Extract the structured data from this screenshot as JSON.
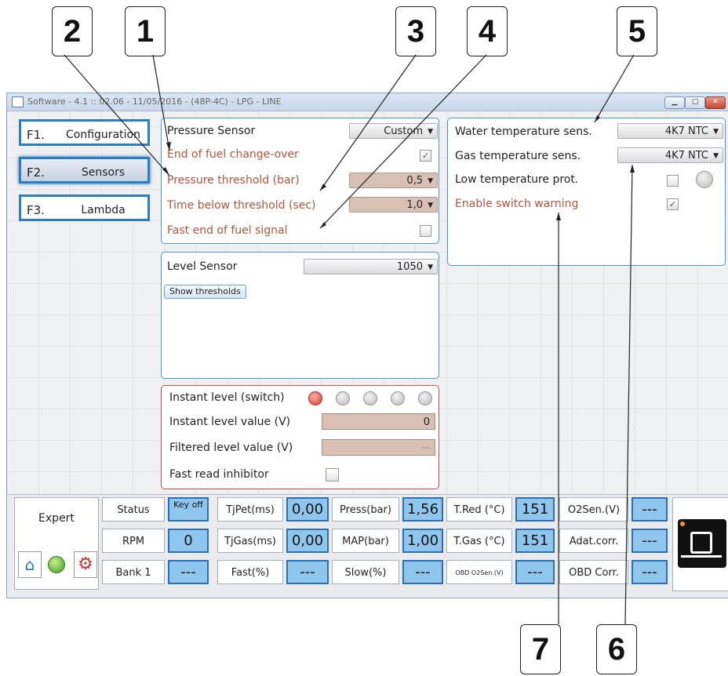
{
  "callouts": [
    "2",
    "1",
    "3",
    "4",
    "5",
    "7",
    "6"
  ],
  "window": {
    "title": "Software - 4.1 :: 02.06 - 11/05/2016 - (48P-4C) - LPG - LINE",
    "buttons": {
      "minimize": "▁",
      "maximize": "▢",
      "close": "✕"
    }
  },
  "nav": [
    {
      "key": "F1.",
      "label": "Configuration"
    },
    {
      "key": "F2.",
      "label": "Sensors"
    },
    {
      "key": "F3.",
      "label": "Lambda"
    }
  ],
  "pressure": {
    "title": "Pressure Sensor",
    "title_value": "Custom",
    "end_of_fuel": "End of fuel change-over",
    "end_of_fuel_checked": "✓",
    "threshold_label": "Pressure threshold (bar)",
    "threshold_value": "0,5",
    "time_label": "Time below threshold (sec)",
    "time_value": "1,0",
    "fast_end_label": "Fast end of fuel signal"
  },
  "level": {
    "title": "Level Sensor",
    "value": "1050",
    "show_thresholds": "Show thresholds"
  },
  "instant": {
    "switch_label": "Instant level (switch)",
    "value_label": "Instant level value (V)",
    "value": "0",
    "filtered_label": "Filtered level value (V)",
    "filtered_value": "---",
    "inhibitor_label": "Fast read inhibitor"
  },
  "temps": {
    "water_label": "Water temperature sens.",
    "water_value": "4K7 NTC",
    "gas_label": "Gas temperature sens.",
    "gas_value": "4K7 NTC",
    "low_label": "Low temperature prot.",
    "warning_label": "Enable switch warning",
    "warning_checked": "✓"
  },
  "status": {
    "mode": "Expert",
    "rows": [
      [
        {
          "label": "Status",
          "value": "Key off"
        },
        {
          "label": "TjPet(ms)",
          "value": "0,00"
        },
        {
          "label": "Press(bar)",
          "value": "1,56"
        },
        {
          "label": "T.Red (°C)",
          "value": "151"
        },
        {
          "label": "O2Sen.(V)",
          "value": "---"
        }
      ],
      [
        {
          "label": "RPM",
          "value": "0"
        },
        {
          "label": "TjGas(ms)",
          "value": "0,00"
        },
        {
          "label": "MAP(bar)",
          "value": "1,00"
        },
        {
          "label": "T.Gas (°C)",
          "value": "151"
        },
        {
          "label": "Adat.corr.",
          "value": "---"
        }
      ],
      [
        {
          "label": "Bank 1",
          "value": "---"
        },
        {
          "label": "Fast(%)",
          "value": "---"
        },
        {
          "label": "Slow(%)",
          "value": "---"
        },
        {
          "label": "OBD O2Sen.(V)",
          "value": "---"
        },
        {
          "label": "OBD Corr.",
          "value": "---"
        }
      ]
    ]
  },
  "colors": {
    "accent": "#2b7ec1",
    "value_box": "#8fc6ee",
    "brown_label": "#b0563c",
    "red_panel": "#c0504d"
  }
}
